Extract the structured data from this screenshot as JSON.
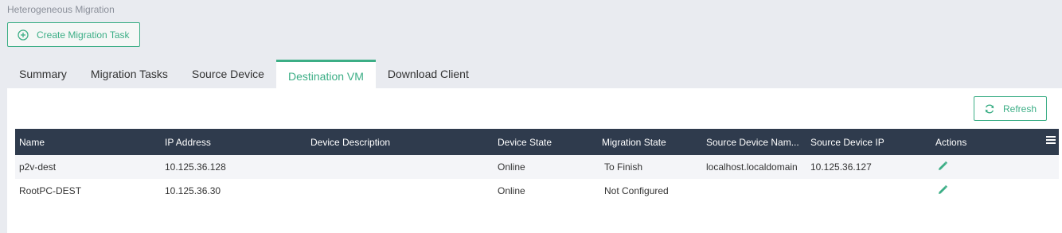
{
  "page": {
    "title": "Heterogeneous Migration"
  },
  "toolbar": {
    "create_label": "Create Migration Task",
    "refresh_label": "Refresh"
  },
  "tabs": [
    {
      "label": "Summary",
      "active": false
    },
    {
      "label": "Migration Tasks",
      "active": false
    },
    {
      "label": "Source Device",
      "active": false
    },
    {
      "label": "Destination VM",
      "active": true
    },
    {
      "label": "Download Client",
      "active": false
    }
  ],
  "table": {
    "columns": [
      "Name",
      "IP Address",
      "Device Description",
      "Device State",
      "Migration State",
      "Source Device Nam...",
      "Source Device IP",
      "Actions"
    ],
    "rows": [
      [
        "p2v-dest",
        "10.125.36.128",
        "",
        "Online",
        "To Finish",
        "localhost.localdomain",
        "10.125.36.127",
        "edit-icon"
      ],
      [
        "RootPC-DEST",
        "10.125.36.30",
        "",
        "Online",
        "Not Configured",
        "",
        "",
        "edit-icon"
      ]
    ]
  },
  "colors": {
    "accent": "#3cae86",
    "header_bg": "#2f3b4d",
    "page_bg": "#e9ebf0"
  }
}
